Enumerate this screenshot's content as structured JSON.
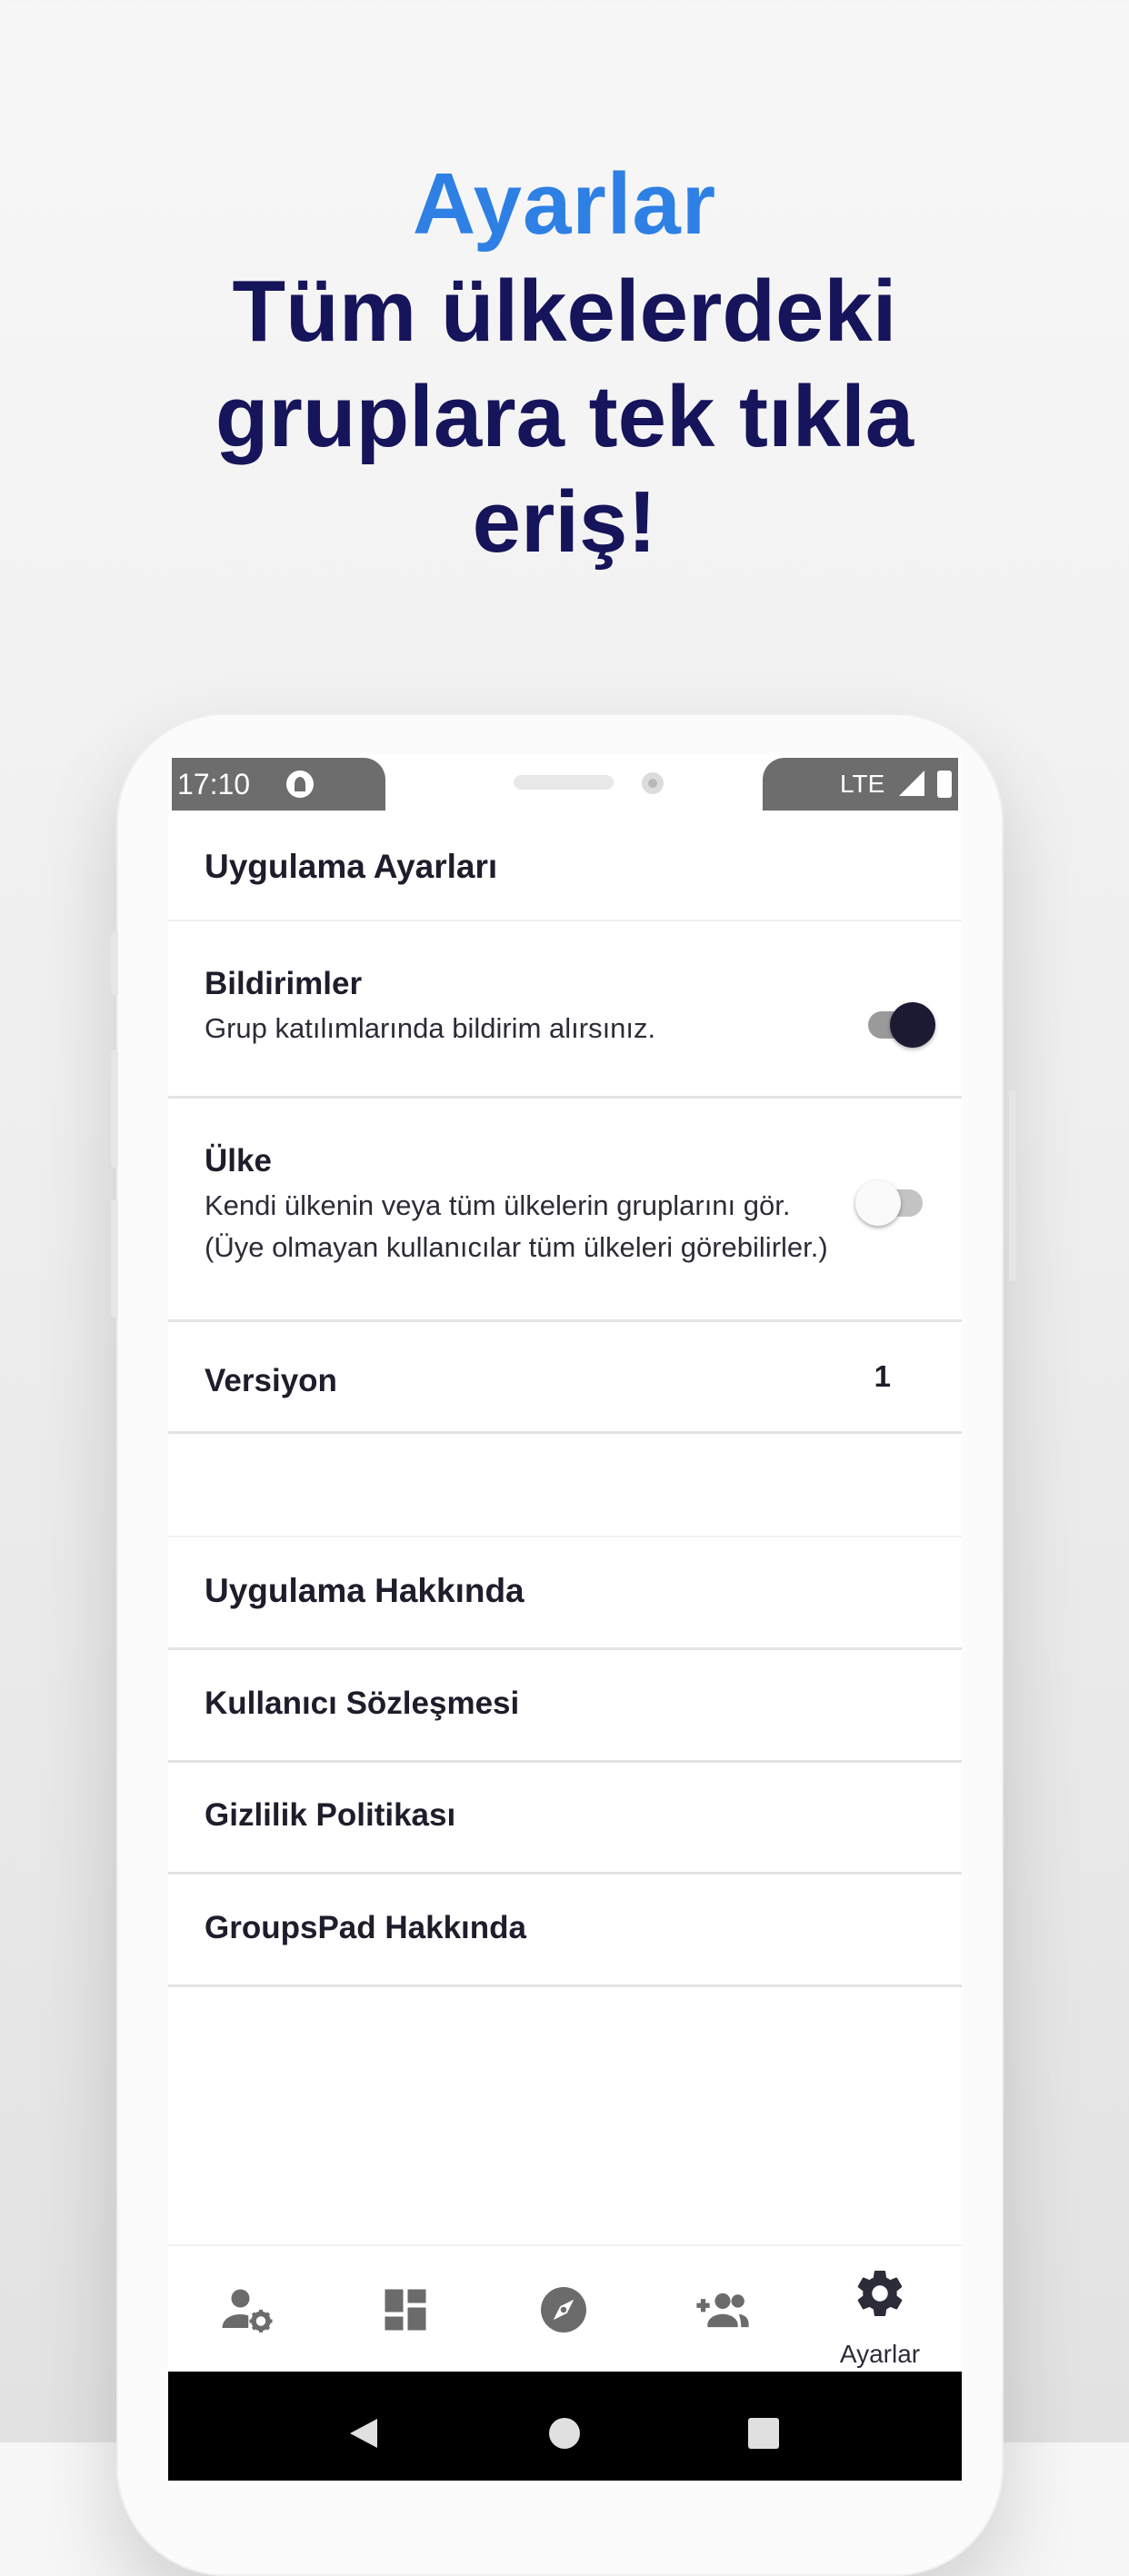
{
  "headline": {
    "accent": "Ayarlar",
    "line1": "Tüm ülkelerdeki",
    "line2": "gruplara tek tıkla",
    "line3": "eriş!"
  },
  "status_bar": {
    "time": "17:10",
    "network": "LTE"
  },
  "settings": {
    "section_title": "Uygulama Ayarları",
    "notifications": {
      "title": "Bildirimler",
      "subtitle": "Grup katılımlarında bildirim alırsınız.",
      "enabled": true
    },
    "country": {
      "title": "Ülke",
      "subtitle_line1": "Kendi ülkenin veya tüm ülkelerin gruplarını gör.",
      "subtitle_line2": "(Üye olmayan kullanıcılar tüm ülkeleri görebilirler.)",
      "enabled": false
    },
    "version": {
      "title": "Versiyon",
      "value": "1"
    }
  },
  "about": {
    "section_title": "Uygulama Hakkında",
    "items": [
      {
        "label": "Kullanıcı Sözleşmesi"
      },
      {
        "label": "Gizlilik Politikası"
      },
      {
        "label": "GroupsPad Hakkında"
      }
    ]
  },
  "bottom_nav": {
    "items": [
      {
        "icon": "user-settings-icon"
      },
      {
        "icon": "dashboard-icon"
      },
      {
        "icon": "compass-icon"
      },
      {
        "icon": "add-group-icon"
      },
      {
        "icon": "gear-icon",
        "label": "Ayarlar",
        "active": true
      }
    ]
  },
  "colors": {
    "accent": "#2f80e4",
    "headline": "#16145a",
    "toggle_on": "#1c1a33",
    "icon": "#6b6b6b"
  }
}
